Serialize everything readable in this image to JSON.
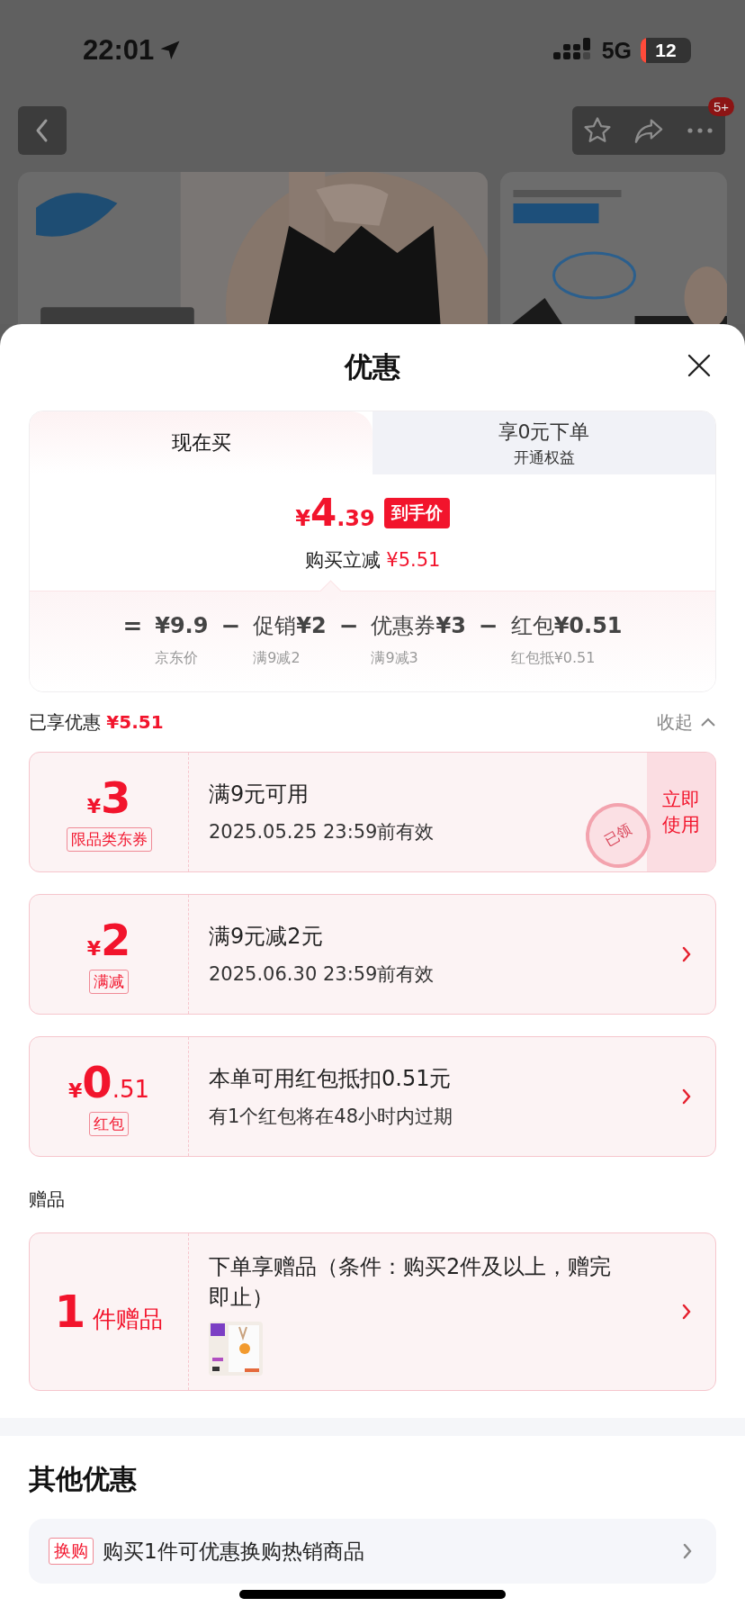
{
  "status_bar": {
    "time": "22:01",
    "network": "5G",
    "battery": "12"
  },
  "nav": {
    "badge": "5+"
  },
  "sheet": {
    "title": "优惠"
  },
  "tabs": [
    {
      "label": "现在买",
      "selected": true
    },
    {
      "label": "享0元下单",
      "sublabel": "开通权益",
      "selected": false
    }
  ],
  "price": {
    "currency": "¥",
    "integer": "4",
    "decimal": ".39",
    "tag": "到手价",
    "saving_label": "购买立减",
    "saving": "¥5.51"
  },
  "breakdown": [
    {
      "op": "=",
      "amount": "¥9.9",
      "note": "京东价"
    },
    {
      "op": "−",
      "label": "促销",
      "amount": "¥2",
      "note": "满9减2"
    },
    {
      "op": "−",
      "label": "优惠券",
      "amount": "¥3",
      "note": "满9减3"
    },
    {
      "op": "−",
      "label": "红包",
      "amount": "¥0.51",
      "note": "红包抵¥0.51"
    }
  ],
  "enjoyed": {
    "label": "已享优惠",
    "amount": "¥5.51",
    "toggle": "收起",
    "expanded": true
  },
  "coupons": [
    {
      "kind": "action",
      "currency": "¥",
      "amount": "3",
      "tag": "限品类东券",
      "title": "满9元可用",
      "subtitle": "2025.05.25 23:59前有效",
      "action": "立即使用",
      "stamp": "已领"
    },
    {
      "kind": "link",
      "currency": "¥",
      "amount": "2",
      "tag": "满减",
      "title": "满9元减2元",
      "subtitle": "2025.06.30 23:59前有效"
    },
    {
      "kind": "link",
      "currency": "¥",
      "amount": "0",
      "decimal": ".51",
      "tag": "红包",
      "title": "本单可用红包抵扣0.51元",
      "subtitle": "有1个红包将在48小时内过期"
    }
  ],
  "gifts": {
    "heading": "赠品",
    "count": "1",
    "unit": "件赠品",
    "text": "下单享赠品（条件：购买2件及以上，赠完即止）"
  },
  "other": {
    "heading": "其他优惠",
    "items": [
      {
        "tag": "换购",
        "text": "购买1件可优惠换购热销商品"
      }
    ]
  }
}
